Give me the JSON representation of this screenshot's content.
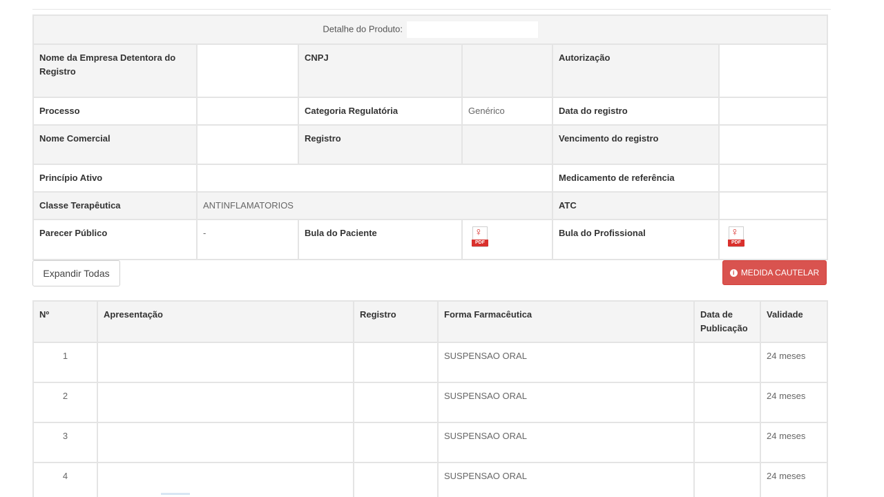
{
  "detail": {
    "header_label": "Detalhe do Produto:",
    "rows": {
      "r1": {
        "l1": "Nome da Empresa Detentora do Registro",
        "v1": "",
        "l2": "CNPJ",
        "v2": "",
        "l3": "Autorização",
        "v3": ""
      },
      "r2": {
        "l1": "Processo",
        "v1": "",
        "l2": "Categoria Regulatória",
        "v2": "Genérico",
        "l3": "Data do registro",
        "v3": ""
      },
      "r3": {
        "l1": "Nome Comercial",
        "v1": "",
        "l2": "Registro",
        "v2": "",
        "l3": "Vencimento do registro",
        "v3": ""
      },
      "r4": {
        "l1": "Princípio Ativo",
        "v1": "",
        "l3": "Medicamento de referência",
        "v3": ""
      },
      "r5": {
        "l1": "Classe Terapêutica",
        "v1": "ANTINFLAMATORIOS",
        "l3": "ATC",
        "v3": ""
      },
      "r6": {
        "l1": "Parecer Público",
        "v1": "-",
        "l2": "Bula do Paciente",
        "l3": "Bula do Profissional"
      }
    },
    "pdf_icon_label": "PDF"
  },
  "buttons": {
    "expand": "Expandir Todas",
    "cautelar": "MEDIDA CAUTELAR"
  },
  "presentations": {
    "headers": [
      "Nº",
      "Apresentação",
      "Registro",
      "Forma Farmacêutica",
      "Data de Publicação",
      "Validade"
    ],
    "rows": [
      {
        "n": "1",
        "apresentacao": "",
        "registro": "",
        "forma": "SUSPENSAO ORAL",
        "data": "",
        "validade": "24 meses"
      },
      {
        "n": "2",
        "apresentacao": "",
        "registro": "",
        "forma": "SUSPENSAO ORAL",
        "data": "",
        "validade": "24 meses"
      },
      {
        "n": "3",
        "apresentacao": "",
        "registro": "",
        "forma": "SUSPENSAO ORAL",
        "data": "",
        "validade": "24 meses"
      },
      {
        "n": "4",
        "apresentacao": "",
        "registro": "",
        "forma": "SUSPENSAO ORAL",
        "data": "",
        "validade": "24 meses"
      }
    ]
  },
  "colors": {
    "danger": "#d9534f",
    "header_bg": "#f4f4f4",
    "border": "#e4e4e4"
  },
  "icons": {
    "pdf": "pdf-icon",
    "info": "info-icon"
  }
}
